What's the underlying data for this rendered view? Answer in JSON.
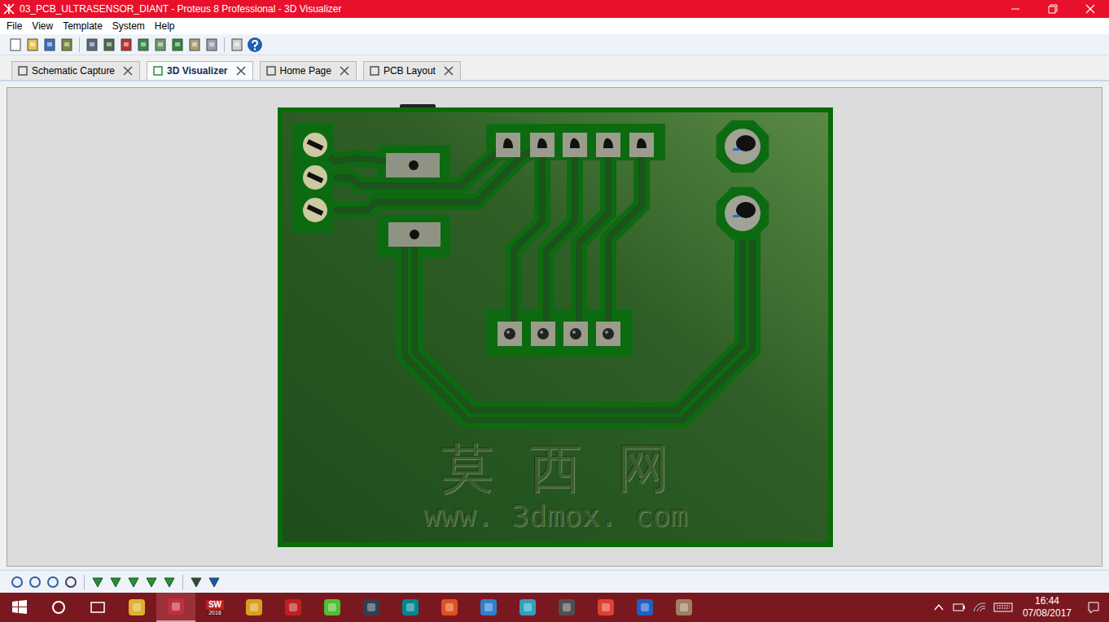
{
  "window": {
    "title": "03_PCB_ULTRASENSOR_DIANT - Proteus 8 Professional - 3D Visualizer"
  },
  "menu": [
    "File",
    "View",
    "Template",
    "System",
    "Help"
  ],
  "tabs": [
    {
      "label": "Schematic Capture",
      "selected": false
    },
    {
      "label": "3D Visualizer",
      "selected": true
    },
    {
      "label": "Home Page",
      "selected": false
    },
    {
      "label": "PCB Layout",
      "selected": false
    }
  ],
  "viewer": {
    "watermark": {
      "title": "莫西网",
      "url": "www. 3dmox. com"
    }
  },
  "taskbar": {
    "sw_icon_text": [
      "SW",
      "2016"
    ],
    "clock": {
      "time": "16:44",
      "date": "07/08/2017"
    }
  }
}
